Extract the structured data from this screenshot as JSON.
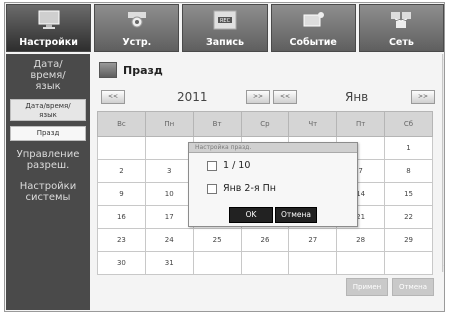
{
  "tabs": [
    {
      "label": "Настройки",
      "icon": "monitor-icon",
      "active": true
    },
    {
      "label": "Устр.",
      "icon": "camera-icon",
      "active": false
    },
    {
      "label": "Запись",
      "icon": "rec-icon",
      "active": false
    },
    {
      "label": "Событие",
      "icon": "event-icon",
      "active": false
    },
    {
      "label": "Сеть",
      "icon": "network-icon",
      "active": false
    }
  ],
  "sidebar": {
    "category_datetime": "Дата/\nвремя/\nязык",
    "sub_datetime": "Дата/время/\nязык",
    "sub_holiday": "Празд",
    "category_permissions": "Управление\nразреш.",
    "category_system": "Настройки\nсистемы"
  },
  "page": {
    "title": "Празд",
    "title_icon": "monitor-icon"
  },
  "nav": {
    "prev": "<<",
    "year": "2011",
    "next": ">>",
    "month_prev": "<<",
    "month": "Янв",
    "month_next": ">>"
  },
  "calendar": {
    "weekdays": [
      "Вс",
      "Пн",
      "Вт",
      "Ср",
      "Чт",
      "Пт",
      "Сб"
    ],
    "rows": [
      [
        "",
        "",
        "",
        "",
        "",
        "",
        "1"
      ],
      [
        "2",
        "3",
        "",
        "",
        "",
        "7",
        "8"
      ],
      [
        "9",
        "10",
        "",
        "",
        "",
        "14",
        "15"
      ],
      [
        "16",
        "17",
        "",
        "",
        "",
        "21",
        "22"
      ],
      [
        "23",
        "24",
        "25",
        "26",
        "27",
        "28",
        "29"
      ],
      [
        "30",
        "31",
        "",
        "",
        "",
        "",
        ""
      ]
    ]
  },
  "buttons": {
    "apply": "Примен",
    "cancel": "Отмена"
  },
  "dialog": {
    "title": "Настройка празд.",
    "options": [
      "1 / 10",
      "Янв 2-я Пн"
    ],
    "ok": "OK",
    "cancel": "Отмена"
  },
  "colors": {
    "active_tab": "#2e2e2e",
    "tab": "#6f6f6f",
    "sidebar": "#4a4a4a",
    "header": "#d5d5d5"
  }
}
